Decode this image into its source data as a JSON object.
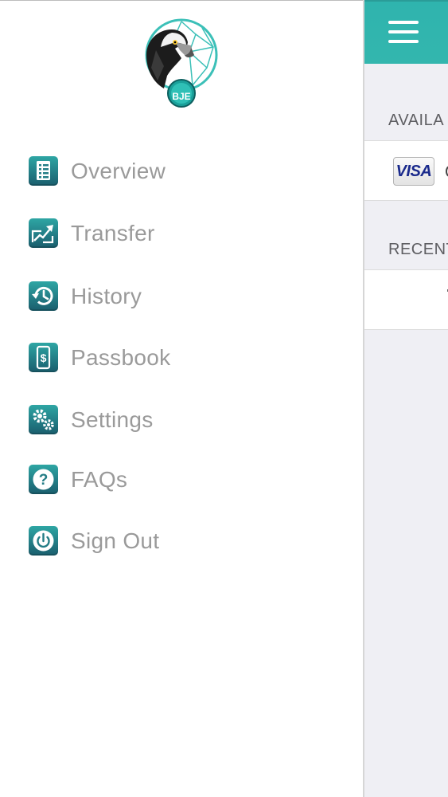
{
  "drawer": {
    "logo": {
      "badge_text": "BJE",
      "icon": "eagle-dreamcatcher-logo"
    },
    "menu": [
      {
        "label": "Overview",
        "icon": "document-list-icon"
      },
      {
        "label": "Transfer",
        "icon": "transfer-arrows-icon"
      },
      {
        "label": "History",
        "icon": "clock-history-icon"
      },
      {
        "label": "Passbook",
        "icon": "phone-dollar-icon"
      },
      {
        "label": "Settings",
        "icon": "gears-icon"
      },
      {
        "label": "FAQs",
        "icon": "question-icon"
      },
      {
        "label": "Sign Out",
        "icon": "power-icon"
      }
    ]
  },
  "main": {
    "available_label": "AVAILA",
    "card_brand": "VISA",
    "recent_label": "RECENT"
  },
  "colors": {
    "accent": "#33b6ae",
    "icon_top": "#2ea6a4",
    "icon_bottom": "#1a5e6d",
    "menu_text": "#9a9a9a",
    "panel_bg": "#efeff4"
  }
}
